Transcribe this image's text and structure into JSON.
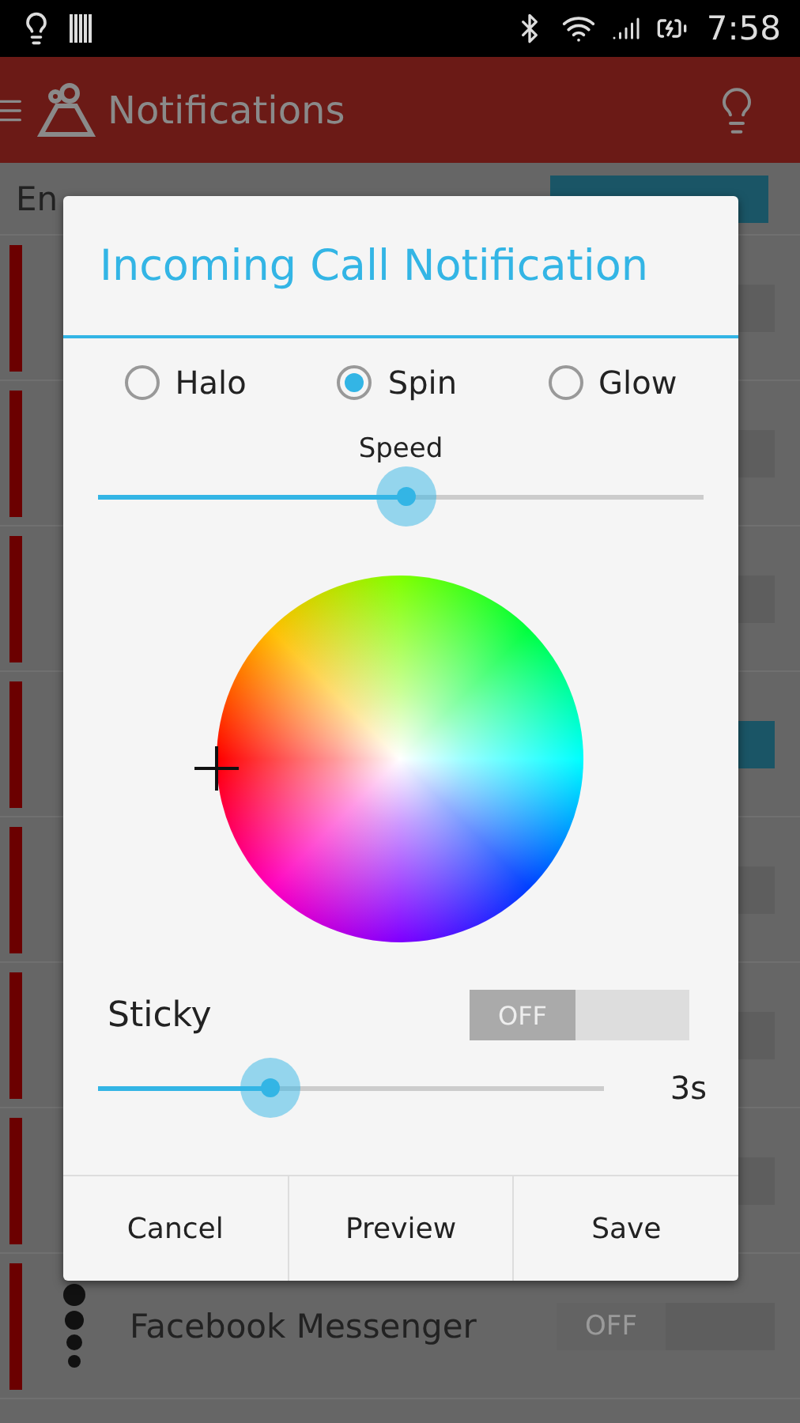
{
  "status_bar": {
    "time": "7:58"
  },
  "app_bar": {
    "title": "Notifications"
  },
  "enable_row": {
    "label": "En",
    "on": true
  },
  "rows": [
    {
      "on": false
    },
    {
      "on": false
    },
    {
      "on": false
    },
    {
      "on": true
    },
    {
      "on": false
    },
    {
      "on": false
    },
    {
      "on": false
    },
    {
      "label": "Facebook Messenger",
      "on": false,
      "toggle_text": "OFF"
    }
  ],
  "dialog": {
    "title": "Incoming Call Notification",
    "effects": [
      {
        "label": "Halo",
        "selected": false
      },
      {
        "label": "Spin",
        "selected": true
      },
      {
        "label": "Glow",
        "selected": false
      }
    ],
    "speed": {
      "label": "Speed",
      "level": 0.51
    },
    "sticky": {
      "label": "Sticky",
      "on": false,
      "toggle_text": "OFF"
    },
    "duration": {
      "level": 0.34,
      "reading": "3s"
    },
    "buttons": [
      "Cancel",
      "Preview",
      "Save"
    ]
  }
}
